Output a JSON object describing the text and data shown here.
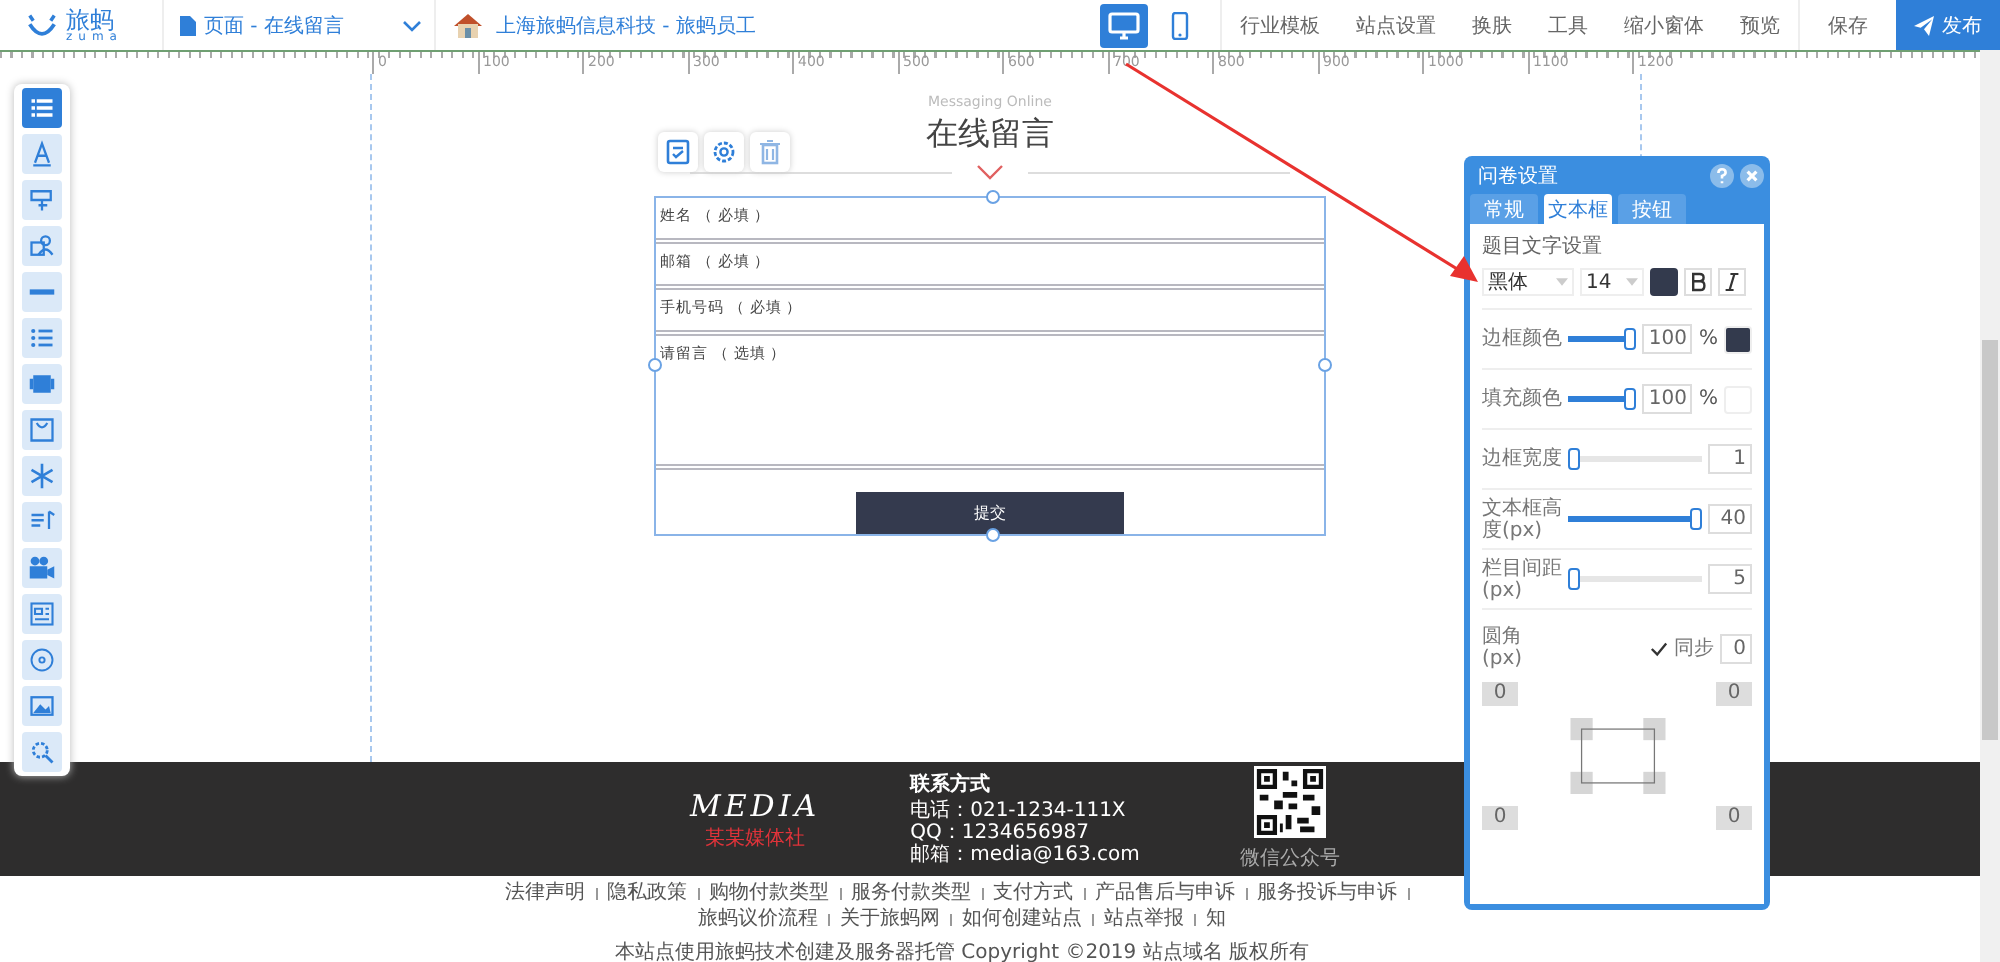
{
  "topbar": {
    "logo": {
      "name": "旅蚂",
      "sub": "zuma"
    },
    "page_selector": "页面 - 在线留言",
    "site": "上海旅蚂信息科技 - 旅蚂员工",
    "devices": [
      {
        "kind": "desktop",
        "selected": true
      },
      {
        "kind": "mobile",
        "selected": false
      }
    ],
    "menu": [
      "行业模板",
      "站点设置",
      "换肤",
      "工具",
      "缩小窗体",
      "预览"
    ],
    "save": "保存",
    "publish": "发布"
  },
  "ruler": {
    "labels": [
      "0",
      "100",
      "200",
      "300",
      "400",
      "500",
      "600",
      "700",
      "800",
      "900",
      "1000",
      "1100",
      "1200"
    ]
  },
  "toolbar": [
    {
      "kind": "form",
      "selected": true
    },
    {
      "kind": "text",
      "selected": false
    },
    {
      "kind": "shape",
      "selected": false
    },
    {
      "kind": "person",
      "selected": false
    },
    {
      "kind": "divider",
      "selected": false
    },
    {
      "kind": "list",
      "selected": false
    },
    {
      "kind": "gallery",
      "selected": false
    },
    {
      "kind": "bag",
      "selected": false
    },
    {
      "kind": "snowflake",
      "selected": false
    },
    {
      "kind": "music",
      "selected": false
    },
    {
      "kind": "video",
      "selected": false
    },
    {
      "kind": "news",
      "selected": false
    },
    {
      "kind": "disc",
      "selected": false
    },
    {
      "kind": "image",
      "selected": false
    },
    {
      "kind": "gear",
      "selected": false
    }
  ],
  "section": {
    "subtitle": "Messaging Online",
    "title": "在线留言"
  },
  "form": {
    "fields": [
      {
        "kind": "input",
        "label": "姓名 （ 必填 ）"
      },
      {
        "kind": "input",
        "label": "邮箱 （ 必填 ）"
      },
      {
        "kind": "input",
        "label": "手机号码 （ 必填 ）"
      },
      {
        "kind": "textarea",
        "label": "请留言 （ 选填 ）"
      }
    ],
    "submit": "提交"
  },
  "panel": {
    "title": "问卷设置",
    "tabs": [
      {
        "label": "常规",
        "selected": false
      },
      {
        "label": "文本框",
        "selected": true
      },
      {
        "label": "按钮",
        "selected": false
      }
    ],
    "font_heading": "题目文字设置",
    "font": {
      "family": "黑体",
      "size": "14",
      "color": "#333a4d"
    },
    "sliders": [
      {
        "label": "边框颜色",
        "level": 1,
        "value": "100",
        "unit": "%",
        "color": "#333a4d"
      },
      {
        "label": "填充颜色",
        "level": 1,
        "value": "100",
        "unit": "%",
        "color": "#ffffff"
      },
      {
        "label": "边框宽度",
        "level": 0,
        "value": "1"
      },
      {
        "label": "文本框高度(px)",
        "level": 1,
        "value": "40"
      },
      {
        "label": "栏目间距(px)",
        "level": 0,
        "value": "5"
      }
    ],
    "radius": {
      "label": "圆角(px)",
      "sync_label": "同步",
      "sync": true,
      "value": "0",
      "corners": [
        "0",
        "0",
        "0",
        "0"
      ]
    }
  },
  "footer": {
    "brand": "MEDIA",
    "brand_sub": "某某媒体社",
    "contact_title": "联系方式",
    "contacts": [
      "电话：021-1234-111X",
      "QQ：1234656987",
      "邮箱：media@163.com"
    ],
    "qr_caption": "微信公众号",
    "links": [
      "法律声明",
      "隐私政策",
      "购物付款类型",
      "服务付款类型",
      "支付方式",
      "产品售后与申诉",
      "服务投诉与申诉",
      "旅蚂议价流程",
      "关于旅蚂网",
      "如何创建站点",
      "站点举报",
      "知"
    ],
    "copyright": "本站点使用旅蚂技术创建及服务器托管 Copyright ©2019 站点域名 版权所有"
  }
}
